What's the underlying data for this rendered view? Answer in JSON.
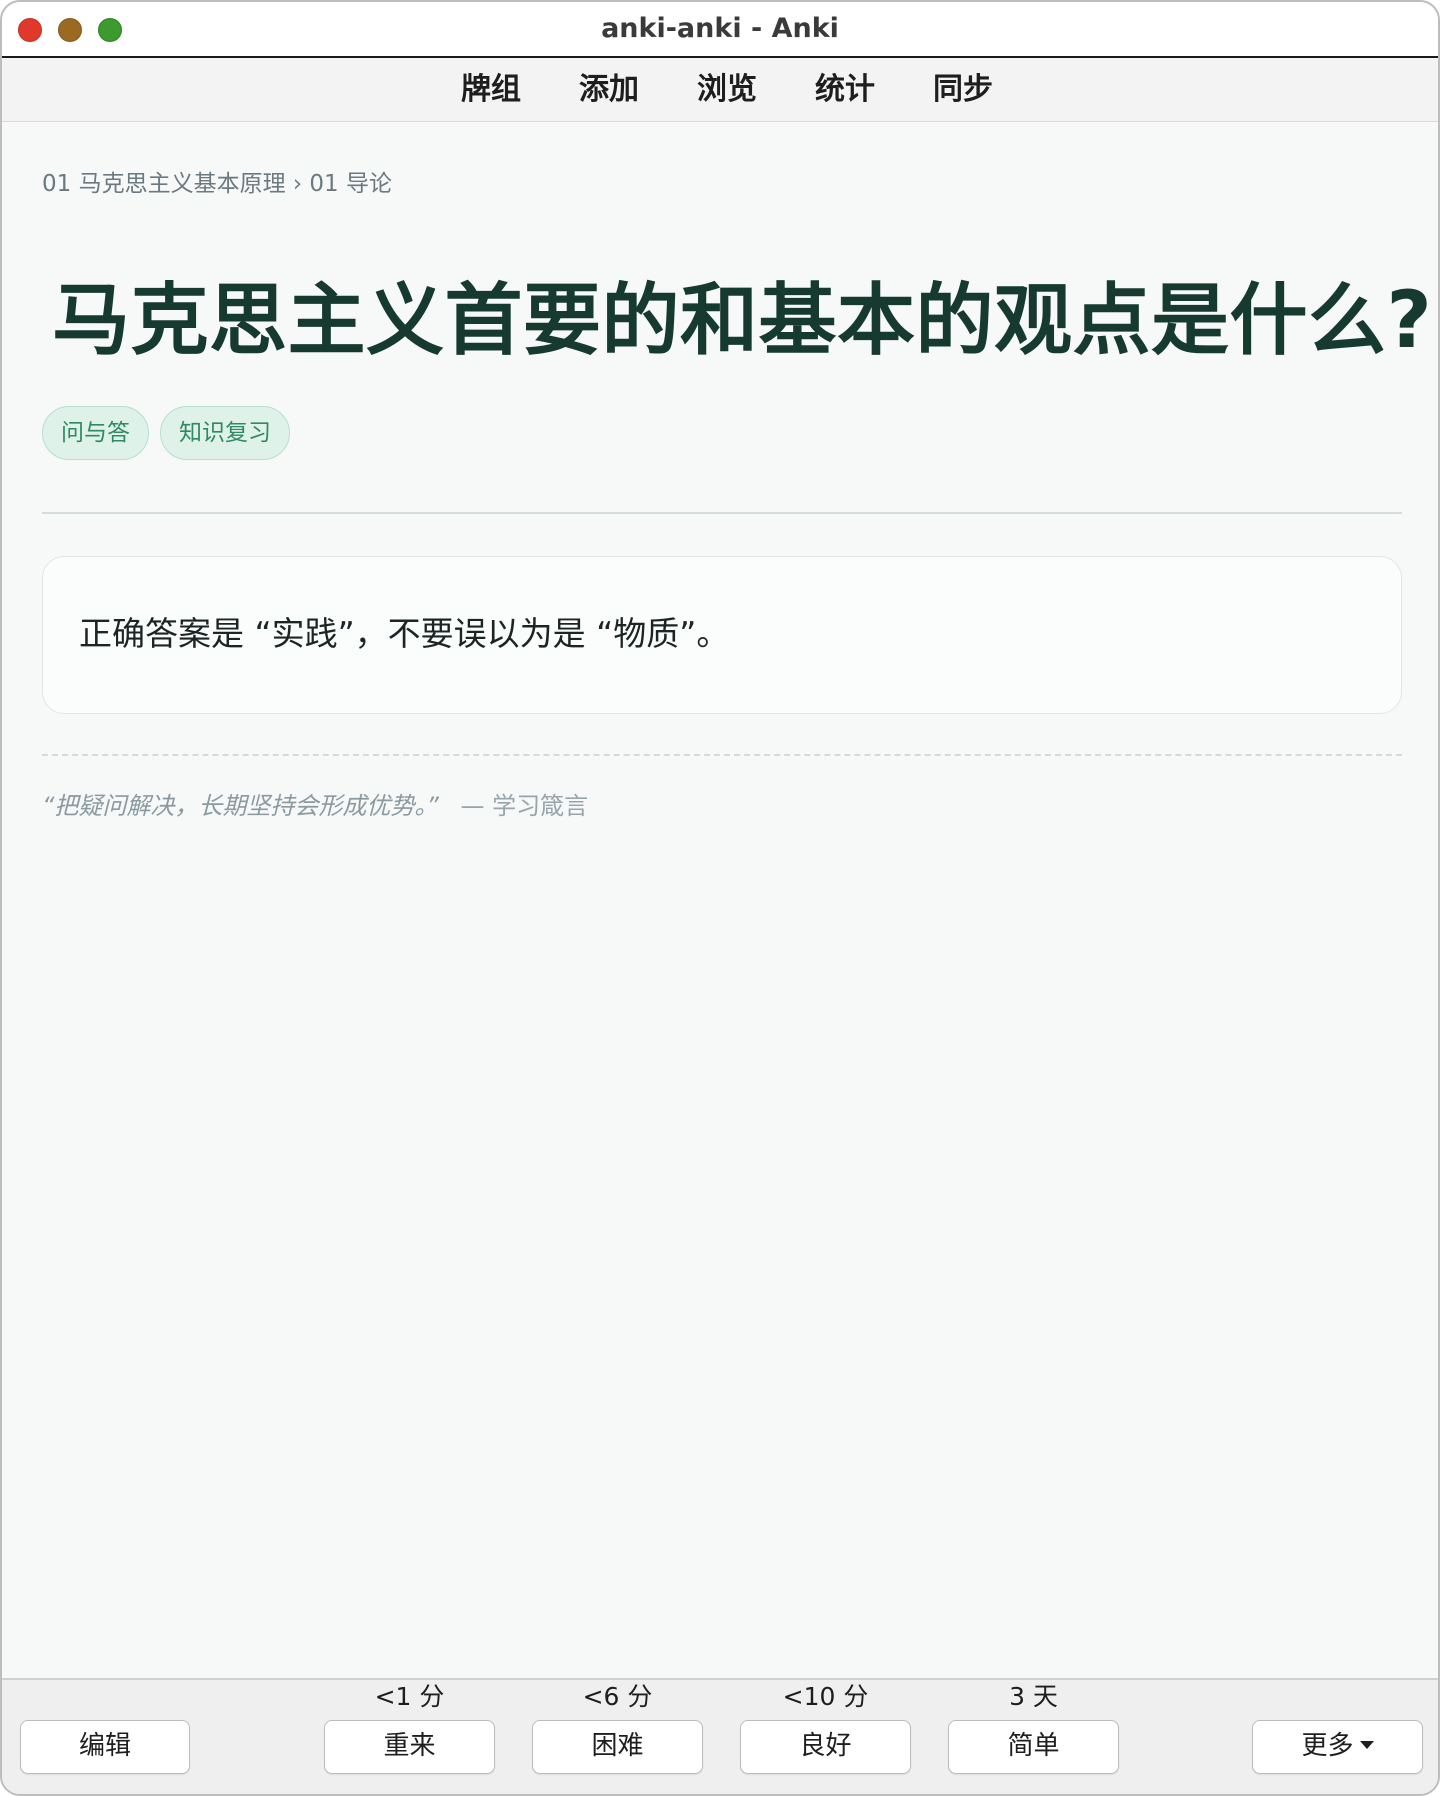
{
  "window": {
    "title": "anki-anki - Anki"
  },
  "menu": {
    "items": [
      {
        "label": "牌组"
      },
      {
        "label": "添加"
      },
      {
        "label": "浏览"
      },
      {
        "label": "统计"
      },
      {
        "label": "同步"
      }
    ]
  },
  "card": {
    "breadcrumb": "01 马克思主义基本原理 › 01 导论",
    "question": "马克思主义首要的和基本的观点是什么?",
    "tags": [
      "问与答",
      "知识复习"
    ],
    "answer": "正确答案是 “实践”，不要误以为是 “物质”。",
    "quote": "“把疑问解决，长期坚持会形成优势。”",
    "quote_source": "— 学习箴言"
  },
  "bottom": {
    "edit_label": "编辑",
    "more_label": "更多",
    "answers": [
      {
        "label": "重来",
        "interval": "<1 分"
      },
      {
        "label": "困难",
        "interval": "<6 分"
      },
      {
        "label": "良好",
        "interval": "<10 分"
      },
      {
        "label": "简单",
        "interval": "3 天"
      }
    ]
  },
  "colors": {
    "title_text": "#163a30",
    "tag_bg": "#dff2ea",
    "tag_text": "#2f8a63",
    "close_button": "#e0392b",
    "minimize_button": "#9b6a22",
    "zoom_button": "#3d9a2f"
  }
}
